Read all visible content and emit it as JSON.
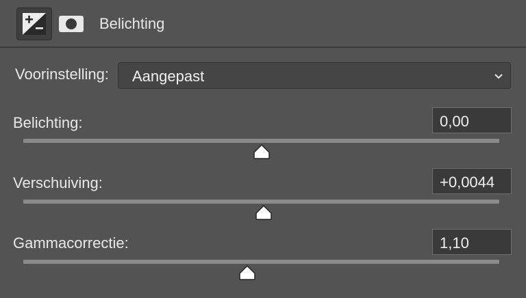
{
  "header": {
    "title": "Belichting",
    "icons": [
      "exposure-adjustment-icon",
      "layer-mask-icon"
    ]
  },
  "preset": {
    "label": "Voorinstelling:",
    "value": "Aangepast"
  },
  "sliders": [
    {
      "label": "Belichting:",
      "value": "0,00",
      "position_fraction": 0.5
    },
    {
      "label": "Verschuiving:",
      "value": "+0,0044",
      "position_fraction": 0.505
    },
    {
      "label": "Gammacorrectie:",
      "value": "1,10",
      "position_fraction": 0.47
    }
  ],
  "colors": {
    "panel_bg": "#535353",
    "field_bg": "#3a3a3a",
    "track": "#8a8a8a",
    "thumb": "#ffffff"
  }
}
